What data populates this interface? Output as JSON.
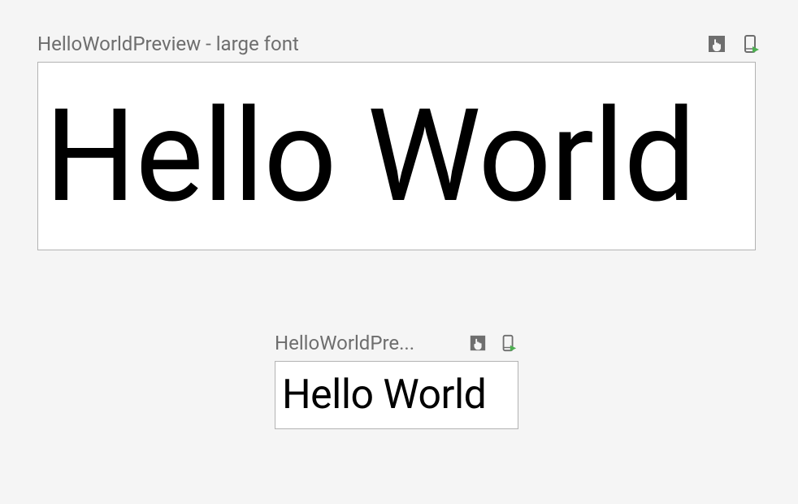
{
  "previews": [
    {
      "title": "HelloWorldPreview - large font",
      "content": "Hello World",
      "icons": {
        "interactive": "interactive-mode-icon",
        "deploy": "deploy-device-icon"
      }
    },
    {
      "title": "HelloWorldPre...",
      "content": "Hello World",
      "icons": {
        "interactive": "interactive-mode-icon",
        "deploy": "deploy-device-icon"
      }
    }
  ],
  "colors": {
    "background": "#f5f5f5",
    "canvas": "#ffffff",
    "border": "#b3b3b3",
    "title": "#6e6e6e",
    "iconDark": "#6e6e6e",
    "iconAccent": "#4CAF50"
  }
}
